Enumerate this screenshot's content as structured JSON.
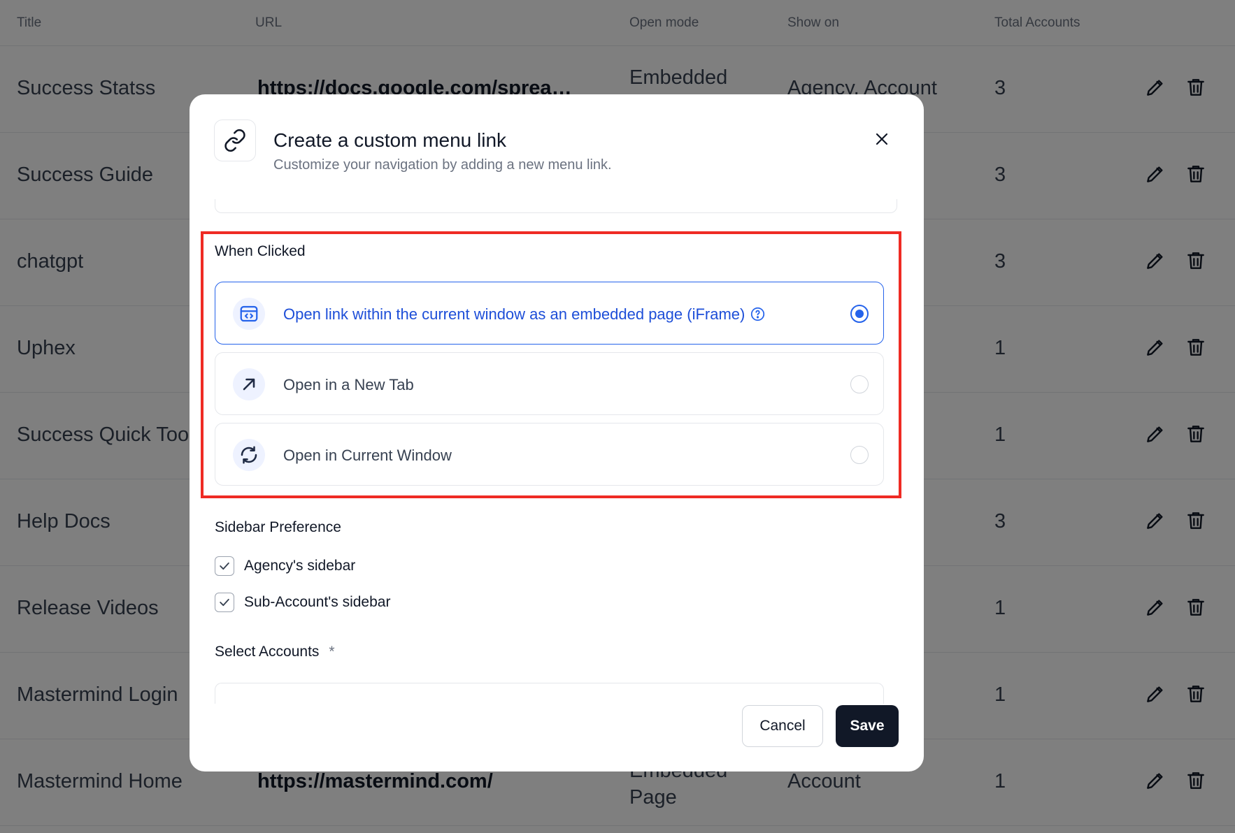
{
  "table": {
    "headers": [
      "Title",
      "URL",
      "Open mode",
      "Show on",
      "Total Accounts"
    ],
    "rows": [
      {
        "title": "Success Statss",
        "url": "https://docs.google.com/spread...",
        "mode": "Embedded Page",
        "show": "Agency, Account",
        "total": "3"
      },
      {
        "title": "Success Guide",
        "url": "",
        "mode": "",
        "show": "",
        "total": "3"
      },
      {
        "title": "chatgpt",
        "url": "",
        "mode": "",
        "show": "",
        "total": "3"
      },
      {
        "title": "Uphex",
        "url": "",
        "mode": "",
        "show": "",
        "total": "1"
      },
      {
        "title": "Success Quick Tools",
        "url": "",
        "mode": "",
        "show": "",
        "total": "1"
      },
      {
        "title": "Help Docs",
        "url": "",
        "mode": "",
        "show": "",
        "total": "3"
      },
      {
        "title": "Release Videos",
        "url": "",
        "mode": "",
        "show": "",
        "total": "1"
      },
      {
        "title": "Mastermind Login",
        "url": "",
        "mode": "",
        "show": "",
        "total": "1"
      },
      {
        "title": "Mastermind Home",
        "url": "https://mastermind.com/",
        "mode": "Embedded Page",
        "show": "Account",
        "total": "1"
      }
    ]
  },
  "modal": {
    "title": "Create a custom menu link",
    "subtitle": "Customize your navigation by adding a new menu link.",
    "when_clicked": {
      "label": "When Clicked",
      "options": [
        {
          "label": "Open link within the current window as an embedded page (iFrame)",
          "icon": "iframe-embed-icon",
          "selected": true
        },
        {
          "label": "Open in a New Tab",
          "icon": "arrow-up-right-icon",
          "selected": false
        },
        {
          "label": "Open in Current Window",
          "icon": "refresh-icon",
          "selected": false
        }
      ]
    },
    "sidebar": {
      "label": "Sidebar Preference",
      "options": [
        {
          "label": "Agency's sidebar",
          "checked": true
        },
        {
          "label": "Sub-Account's sidebar",
          "checked": true
        }
      ]
    },
    "accounts": {
      "label": "Select Accounts",
      "required_mark": "*"
    },
    "buttons": {
      "cancel": "Cancel",
      "save": "Save"
    }
  },
  "colors": {
    "accent": "#2563eb",
    "highlight": "#ef2b24",
    "overlay": "rgba(0,0,0,0.5)"
  }
}
